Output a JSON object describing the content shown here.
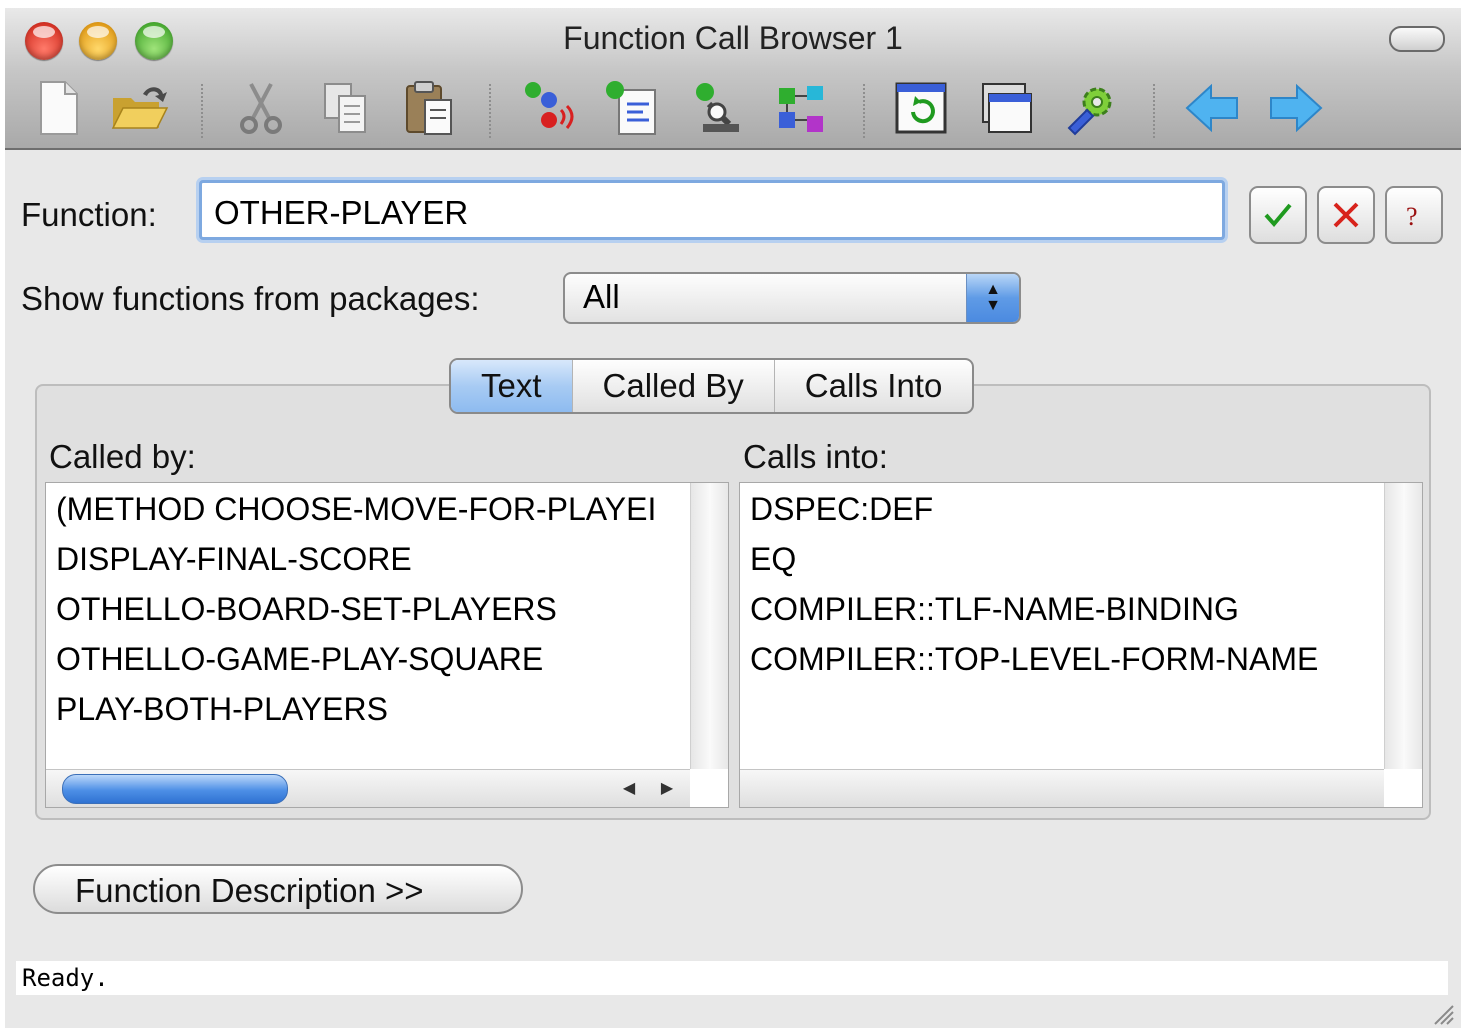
{
  "window": {
    "title": "Function Call Browser 1"
  },
  "toolbar": {
    "items": [
      {
        "name": "new-file-icon"
      },
      {
        "name": "open-folder-icon"
      },
      {
        "name": "cut-icon"
      },
      {
        "name": "copy-icon"
      },
      {
        "name": "paste-icon"
      },
      {
        "name": "callers-icon"
      },
      {
        "name": "list-view-icon"
      },
      {
        "name": "inspect-icon"
      },
      {
        "name": "graph-icon"
      },
      {
        "name": "refresh-icon"
      },
      {
        "name": "window-icon"
      },
      {
        "name": "preferences-gear-icon"
      },
      {
        "name": "back-arrow-icon"
      },
      {
        "name": "forward-arrow-icon"
      }
    ]
  },
  "function": {
    "label": "Function:",
    "value": "OTHER-PLAYER"
  },
  "packages": {
    "label": "Show functions from packages:",
    "selected": "All"
  },
  "tabs": [
    "Text",
    "Called By",
    "Calls Into"
  ],
  "called_by": {
    "label": "Called by:",
    "items": [
      "(METHOD CHOOSE-MOVE-FOR-PLAYEI",
      "DISPLAY-FINAL-SCORE",
      "OTHELLO-BOARD-SET-PLAYERS",
      "OTHELLO-GAME-PLAY-SQUARE",
      "PLAY-BOTH-PLAYERS"
    ],
    "scroll_position": 0.0
  },
  "calls_into": {
    "label": "Calls into:",
    "items": [
      "DSPEC:DEF",
      "EQ",
      "COMPILER::TLF-NAME-BINDING",
      "COMPILER::TOP-LEVEL-FORM-NAME"
    ]
  },
  "description_button": "Function Description >>",
  "status": "Ready.",
  "colors": {
    "accent_blue": "#5f9be6",
    "ok_green": "#1f9a1f",
    "cancel_red": "#d8231c"
  }
}
